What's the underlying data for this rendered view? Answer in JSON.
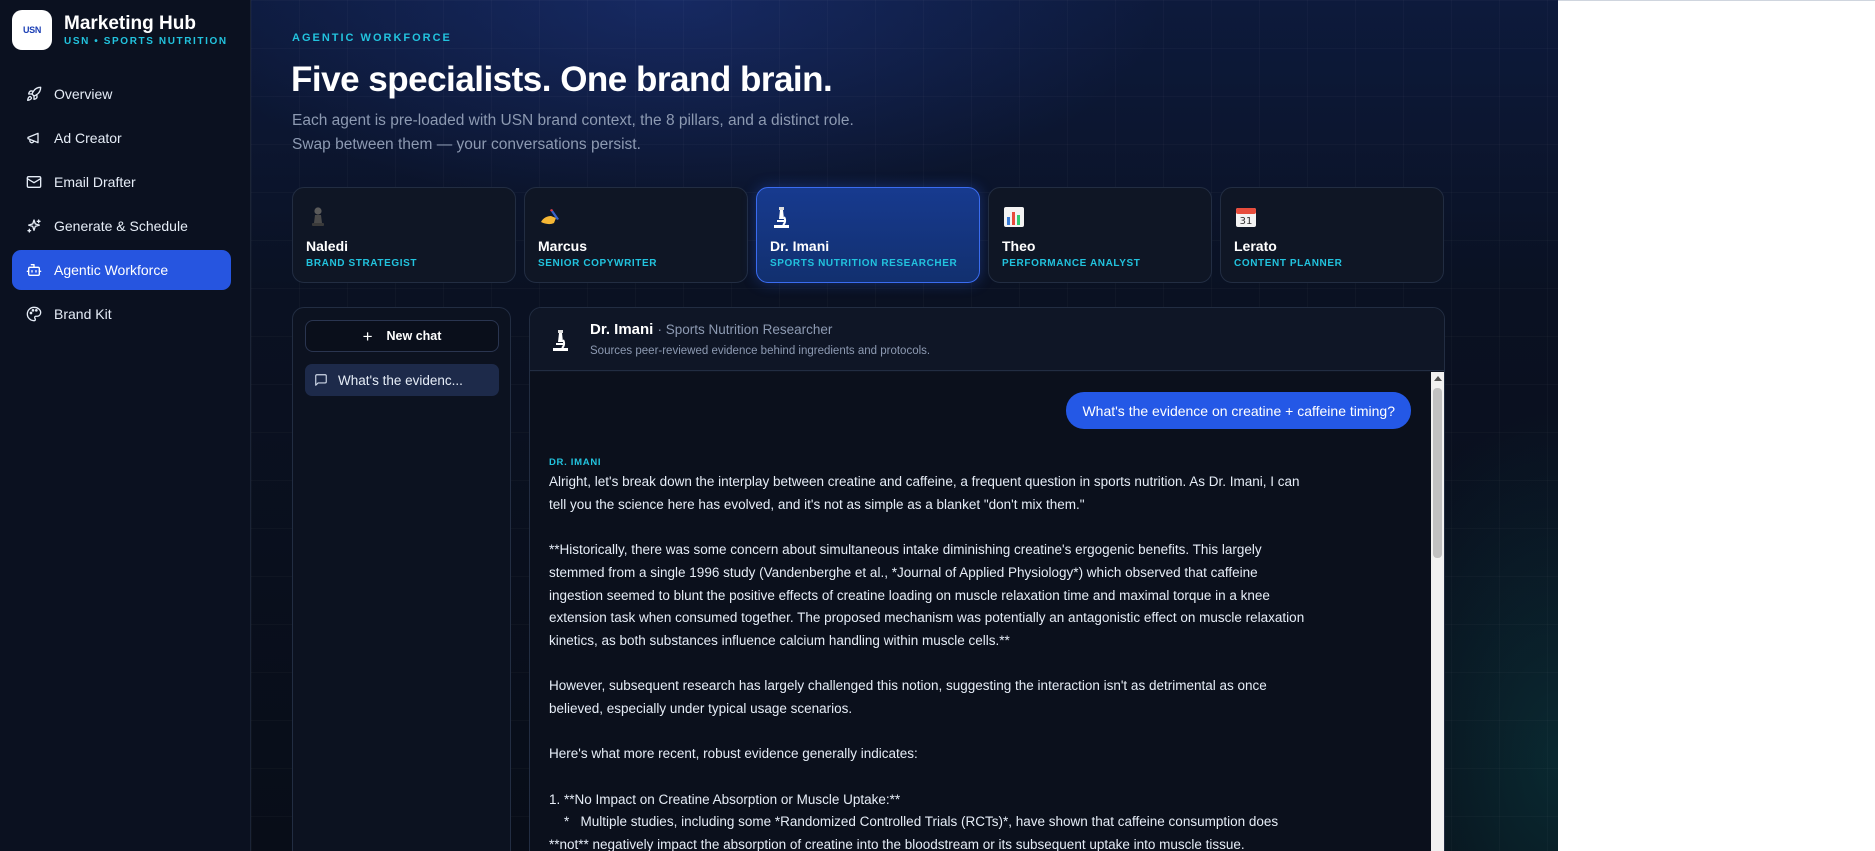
{
  "brand": {
    "logo_text": "USN",
    "title": "Marketing Hub",
    "subtitle": "USN • SPORTS NUTRITION"
  },
  "nav": [
    {
      "label": "Overview",
      "icon": "rocket-icon"
    },
    {
      "label": "Ad Creator",
      "icon": "megaphone-icon"
    },
    {
      "label": "Email Drafter",
      "icon": "mail-icon"
    },
    {
      "label": "Generate & Schedule",
      "icon": "sparkles-icon"
    },
    {
      "label": "Agentic Workforce",
      "icon": "bot-icon",
      "active": true
    },
    {
      "label": "Brand Kit",
      "icon": "palette-icon"
    }
  ],
  "page": {
    "eyebrow": "AGENTIC WORKFORCE",
    "headline": "Five specialists. One brand brain.",
    "subhead_line1": "Each agent is pre-loaded with USN brand context, the 8 pillars, and a distinct role.",
    "subhead_line2": "Swap between them — your conversations persist."
  },
  "agents": [
    {
      "emoji": "♟️",
      "icon": "chess-pawn-icon",
      "name": "Naledi",
      "role": "BRAND STRATEGIST"
    },
    {
      "emoji": "✍️",
      "icon": "writing-hand-icon",
      "name": "Marcus",
      "role": "SENIOR COPYWRITER"
    },
    {
      "emoji": "🔬",
      "icon": "microscope-icon",
      "name": "Dr. Imani",
      "role": "SPORTS NUTRITION RESEARCHER",
      "active": true
    },
    {
      "emoji": "📊",
      "icon": "bar-chart-icon",
      "name": "Theo",
      "role": "PERFORMANCE ANALYST"
    },
    {
      "emoji": "📅",
      "icon": "calendar-icon",
      "name": "Lerato",
      "role": "CONTENT PLANNER"
    }
  ],
  "chats": {
    "new_chat_label": "New chat",
    "items": [
      "What's the evidenc..."
    ]
  },
  "conversation": {
    "agent_emoji": "🔬",
    "agent_name": "Dr. Imani",
    "agent_role": "· Sports Nutrition Researcher",
    "agent_desc": "Sources peer-reviewed evidence behind ingredients and protocols.",
    "user_message": "What's the evidence on creatine + caffeine timing?",
    "bot_label": "DR. IMANI",
    "bot_paragraphs": [
      "Alright, let's break down the interplay between creatine and caffeine, a frequent question in sports nutrition. As Dr. Imani, I can tell you the science here has evolved, and it's not as simple as a blanket \"don't mix them.\"",
      "**Historically, there was some concern about simultaneous intake diminishing creatine's ergogenic benefits. This largely stemmed from a single 1996 study (Vandenberghe et al., *Journal of Applied Physiology*) which observed that caffeine ingestion seemed to blunt the positive effects of creatine loading on muscle relaxation time and maximal torque in a knee extension task when consumed together. The proposed mechanism was potentially an antagonistic effect on muscle relaxation kinetics, as both substances influence calcium handling within muscle cells.**",
      "However, subsequent research has largely challenged this notion, suggesting the interaction isn't as detrimental as once believed, especially under typical usage scenarios.",
      "Here's what more recent, robust evidence generally indicates:"
    ],
    "list_line1": "1.  **No Impact on Creatine Absorption or Muscle Uptake:**",
    "list_line2": "    *   Multiple studies, including some *Randomized Controlled Trials (RCTs)*, have shown that caffeine consumption does **not** negatively impact the absorption of creatine into the bloodstream or its subsequent uptake into muscle tissue."
  }
}
